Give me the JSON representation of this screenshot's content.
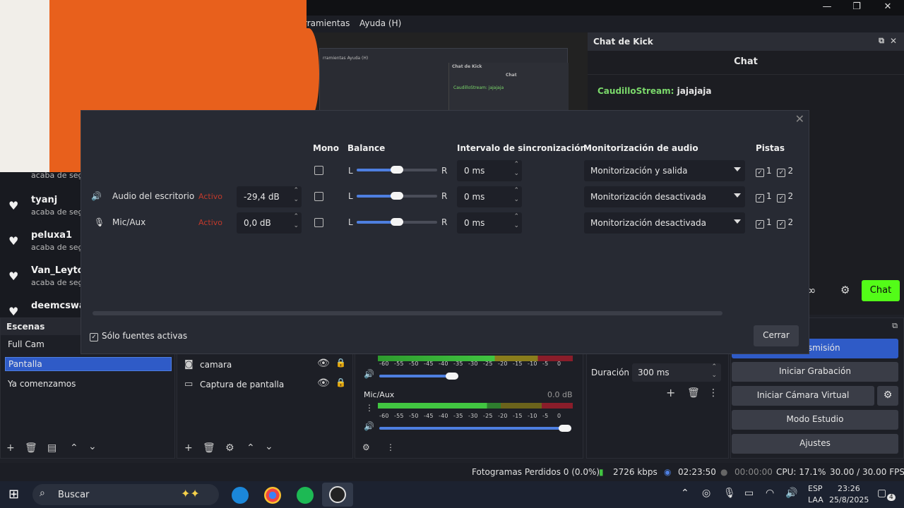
{
  "menu": {
    "tools": "rramientas",
    "help": "Ayuda (H)"
  },
  "window_controls": {
    "minimize": "—",
    "restore": "❐",
    "close": "✕"
  },
  "chat_dock": {
    "dock_title": "Chat de Kick",
    "header": "Chat",
    "message_user": "CaudilloStream:",
    "message_text": "jajajaja",
    "chat_button": "Chat",
    "chat_button_color": "#53fc18"
  },
  "followers": [
    {
      "name": "",
      "sub": "acaba de seg"
    },
    {
      "name": "tyanj",
      "sub": "acaba de seg"
    },
    {
      "name": "peluxa1",
      "sub": "acaba de seg"
    },
    {
      "name": "Van_Leytor",
      "sub": "acaba de seg"
    },
    {
      "name": "deemcswa",
      "sub": ""
    }
  ],
  "audio_dialog": {
    "columns": {
      "mono": "Mono",
      "balance": "Balance",
      "sync": "Intervalo de sincronización",
      "monitoring": "Monitorización de audio",
      "tracks": "Pistas"
    },
    "rows": [
      {
        "name": "",
        "status": "",
        "volume": "",
        "balance_left": "L",
        "balance_right": "R",
        "balance_value": 0.5,
        "sync": "0 ms",
        "monitoring": "Monitorización y salida",
        "track1": "1",
        "track2": "2"
      },
      {
        "name": "Audio del escritorio",
        "status": "Activo",
        "volume": "-29,4 dB",
        "balance_left": "L",
        "balance_right": "R",
        "balance_value": 0.5,
        "sync": "0 ms",
        "monitoring": "Monitorización desactivada",
        "track1": "1",
        "track2": "2"
      },
      {
        "name": "Mic/Aux",
        "status": "Activo",
        "volume": "0,0 dB",
        "balance_left": "L",
        "balance_right": "R",
        "balance_value": 0.5,
        "sync": "0 ms",
        "monitoring": "Monitorización desactivada",
        "track1": "1",
        "track2": "2"
      }
    ],
    "only_active_label": "Sólo fuentes activas",
    "close_button": "Cerrar"
  },
  "scenes": {
    "title": "Escenas",
    "items": [
      "Full Cam",
      "Pantalla",
      "Ya comenzamos"
    ],
    "selected": "Pantalla"
  },
  "sources": {
    "items": [
      "camara",
      "Captura de pantalla"
    ]
  },
  "mixer": {
    "mic_label": "Mic/Aux",
    "mic_db": "0.0 dB",
    "tick_labels": [
      "-60",
      "-55",
      "-50",
      "-45",
      "-40",
      "-35",
      "-30",
      "-25",
      "-20",
      "-15",
      "-10",
      "-5",
      "0"
    ]
  },
  "transitions": {
    "duration_label": "Duración",
    "duration_value": "300 ms"
  },
  "controls": {
    "stream": "Transmisión",
    "record": "Iniciar Grabación",
    "virtual_cam": "Iniciar Cámara Virtual",
    "studio": "Modo Estudio",
    "settings": "Ajustes"
  },
  "status": {
    "dropped": "Fotogramas Perdidos 0 (0.0%)",
    "bitrate": "2726 kbps",
    "stream_time": "02:23:50",
    "rec_time": "00:00:00",
    "cpu": "CPU: 17.1%",
    "fps": "30.00 / 30.00 FPS"
  },
  "taskbar": {
    "search": "Buscar",
    "lang": "ESP",
    "lang_sub": "LAA",
    "time": "23:26",
    "date": "25/8/2025",
    "notif_count": "4"
  },
  "preview_mini": {
    "menu": "rramientas  Ayuda (H)",
    "chat": "Chat de Kick",
    "chat_head": "Chat",
    "msg": "CaudilloStream: jajajaja"
  }
}
